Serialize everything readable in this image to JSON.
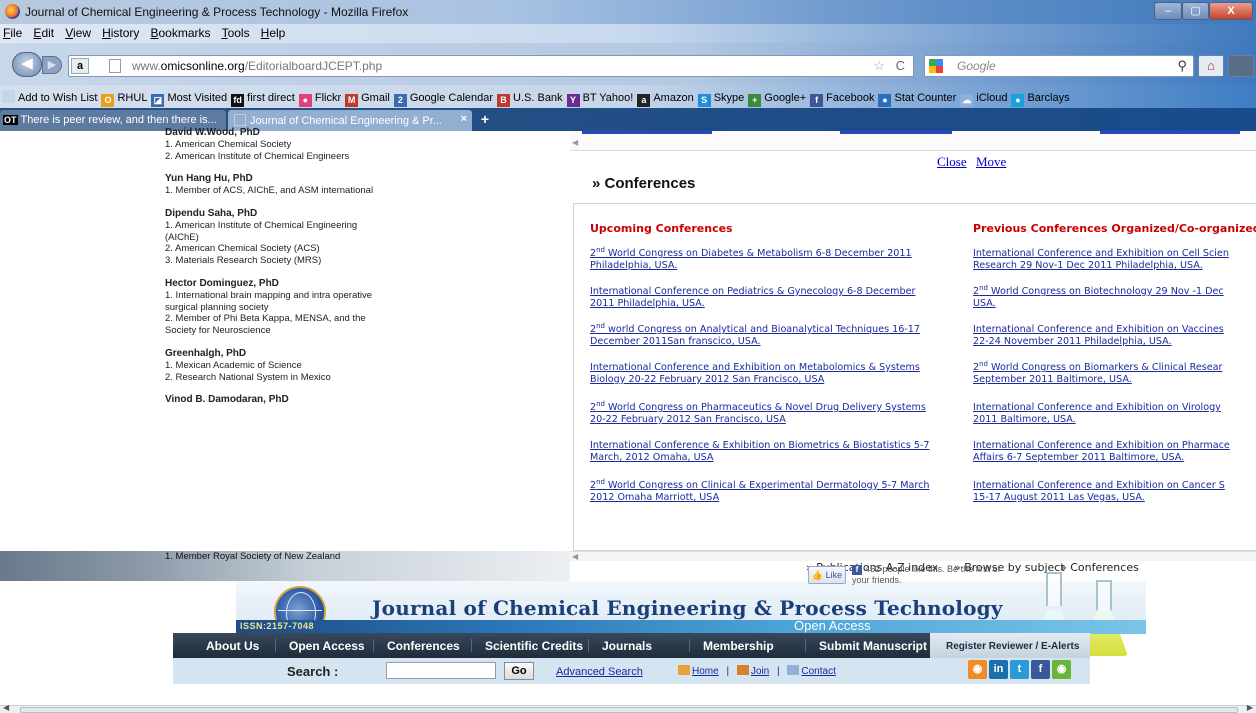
{
  "window": {
    "title": "Journal of Chemical Engineering & Process Technology - Mozilla Firefox",
    "min": "–",
    "max": "▢",
    "close": "X"
  },
  "menu": [
    "File",
    "Edit",
    "View",
    "History",
    "Bookmarks",
    "Tools",
    "Help"
  ],
  "nav": {
    "back_icon": "◀",
    "forward_icon": "▶",
    "site_badge": "a",
    "url_prefix": "www.",
    "url_domain": "omicsonline.org",
    "url_path": "/EditorialboardJCEPT.php",
    "star_icon": "☆",
    "reload_icon": "C",
    "search_placeholder": "Google",
    "magnifier_icon": "⚲",
    "home_icon": "⌂"
  },
  "bookmarks": [
    {
      "label": "Add to Wish List",
      "icon": "",
      "color": "#c6d6ea"
    },
    {
      "label": "RHUL",
      "icon": "O",
      "color": "#e6a019"
    },
    {
      "label": "Most Visited",
      "icon": "◪",
      "color": "#3d6bb0"
    },
    {
      "label": "first direct",
      "icon": "fd",
      "color": "#111111"
    },
    {
      "label": "Flickr",
      "icon": "●",
      "color": "#e0407c"
    },
    {
      "label": "Gmail",
      "icon": "M",
      "color": "#c0392b"
    },
    {
      "label": "Google Calendar",
      "icon": "2",
      "color": "#3d6bb0"
    },
    {
      "label": "U.S. Bank",
      "icon": "B",
      "color": "#c0392b"
    },
    {
      "label": "BT Yahoo!",
      "icon": "Y",
      "color": "#6a2c91"
    },
    {
      "label": "Amazon",
      "icon": "a",
      "color": "#222222"
    },
    {
      "label": "Skype",
      "icon": "S",
      "color": "#1e90d6"
    },
    {
      "label": "Google+",
      "icon": "+",
      "color": "#3b8a3b"
    },
    {
      "label": "Facebook",
      "icon": "f",
      "color": "#3b5998"
    },
    {
      "label": "Stat Counter",
      "icon": "●",
      "color": "#2a6fbf"
    },
    {
      "label": "iCloud",
      "icon": "☁",
      "color": "#8fb0d8"
    },
    {
      "label": "Barclays",
      "icon": "●",
      "color": "#1aa0dd"
    }
  ],
  "tabs": {
    "tab1_badge": "OT",
    "tab1_label": "There is peer review, and then there is...",
    "tab2_label": "Journal of Chemical Engineering & Pr...",
    "tab2_close": "×",
    "new_tab": "+"
  },
  "editors": [
    {
      "name": "David W.Wood, PhD",
      "lines": [
        "1. American Chemical Society",
        "2. American Institute of Chemical Engineers"
      ]
    },
    {
      "name": "Yun Hang Hu, PhD",
      "lines": [
        "1. Member of ACS, AIChE, and ASM international"
      ]
    },
    {
      "name": "Dipendu Saha, PhD",
      "lines": [
        "1. American Institute of Chemical Engineering (AIChE)",
        "2. American Chemical Society (ACS)",
        "3. Materials Research Society (MRS)"
      ]
    },
    {
      "name": "Hector Dominguez, PhD",
      "lines": [
        "1. International brain mapping and intra operative surgical planning society",
        "2. Member of Phi Beta Kappa, MENSA, and the Society for Neuroscience"
      ]
    },
    {
      "name": "Greenhalgh, PhD",
      "lines": [
        "1. Mexican Academic of Science",
        "2. Research National System in Mexico"
      ]
    },
    {
      "name": "Vinod B. Damodaran, PhD",
      "lines": []
    }
  ],
  "editor_tail": "1. Member Royal Society of New Zealand",
  "popup": {
    "close": "Close",
    "move": "Move",
    "heading": "» Conferences",
    "upcoming_heading": "Upcoming Conferences",
    "previous_heading": "Previous Conferences Organized/Co-organized",
    "upcoming": [
      {
        "sup": "nd",
        "pre": "2",
        "l1": " World Congress on Diabetes & Metabolism 6-8 December 2011",
        "l2": "Philadelphia, USA."
      },
      {
        "sup": "",
        "pre": "",
        "l1": "International Conference on Pediatrics & Gynecology 6-8 December",
        "l2": "2011 Philadelphia, USA."
      },
      {
        "sup": "nd",
        "pre": "2",
        "l1": " world Congress on Analytical and Bioanalytical Techniques 16-17",
        "l2": "December 2011San franscico, USA."
      },
      {
        "sup": "",
        "pre": "",
        "l1": "International Conference and Exhibition on Metabolomics & Systems",
        "l2": "Biology 20-22 February 2012 San Francisco, USA"
      },
      {
        "sup": "nd",
        "pre": "2",
        "l1": " World Congress on Pharmaceutics & Novel Drug Delivery Systems",
        "l2": "20-22 February 2012 San Francisco, USA"
      },
      {
        "sup": "",
        "pre": "",
        "l1": "International Conference & Exhibition on Biometrics & Biostatistics 5-7",
        "l2": "March, 2012 Omaha, USA"
      },
      {
        "sup": "nd",
        "pre": "2",
        "l1": " World Congress on Clinical & Experimental Dermatology 5-7 March",
        "l2": "2012 Omaha Marriott, USA"
      }
    ],
    "previous": [
      {
        "sup": "",
        "pre": "",
        "l1": "International Conference and Exhibition on Cell Scien",
        "l2": "Research 29 Nov-1 Dec 2011 Philadelphia, USA."
      },
      {
        "sup": "nd",
        "pre": "2",
        "l1": " World Congress on Biotechnology 29 Nov -1 Dec",
        "l2": "USA."
      },
      {
        "sup": "",
        "pre": "",
        "l1": "International Conference and Exhibition on Vaccines",
        "l2": "22-24 November 2011 Philadelphia, USA."
      },
      {
        "sup": "nd",
        "pre": "2",
        "l1": " World Congress on Biomarkers & Clinical Resear",
        "l2": "September 2011 Baltimore, USA."
      },
      {
        "sup": "",
        "pre": "",
        "l1": "International Conference and Exhibition on Virology",
        "l2": "2011 Baltimore, USA."
      },
      {
        "sup": "",
        "pre": "",
        "l1": "International Conference and Exhibition on Pharmace",
        "l2": "Affairs 6-7 September 2011 Baltimore, USA."
      },
      {
        "sup": "",
        "pre": "",
        "l1": "International Conference and Exhibition on Cancer S",
        "l2": "15-17 August 2011 Las Vegas, USA."
      }
    ]
  },
  "subnav": {
    "a": "» Publications A-Z index",
    "b": "» Browse by subject",
    "c": "» Conferences"
  },
  "banner": {
    "like": "Like",
    "fb_text": "452 people like this. Be the first of your friends.",
    "title": "Journal of Chemical Engineering & Process Technology",
    "open_access": "Open Access",
    "issn": "ISSN:2157-7048"
  },
  "mainnav": [
    "About Us",
    "Open Access",
    "Conferences",
    "Scientific Credits",
    "Journals",
    "Membership",
    "Submit Manuscript"
  ],
  "register": "Register Reviewer  /  E-Alerts",
  "search": {
    "label": "Search :",
    "go": "Go",
    "advanced": "Advanced Search",
    "home": "Home",
    "join": "Join",
    "contact": "Contact",
    "sep": "|"
  },
  "social": [
    {
      "icon": "rss-icon",
      "glyph": "◉",
      "color": "#f08b2a"
    },
    {
      "icon": "linkedin-icon",
      "glyph": "in",
      "color": "#1b6fad"
    },
    {
      "icon": "twitter-icon",
      "glyph": "t",
      "color": "#2a9bd8"
    },
    {
      "icon": "facebook-icon",
      "glyph": "f",
      "color": "#3b5998"
    },
    {
      "icon": "rss-green-icon",
      "glyph": "◉",
      "color": "#6ab43a"
    }
  ],
  "scroll": {
    "left": "◀",
    "right": "▶",
    "grip": "|||"
  }
}
